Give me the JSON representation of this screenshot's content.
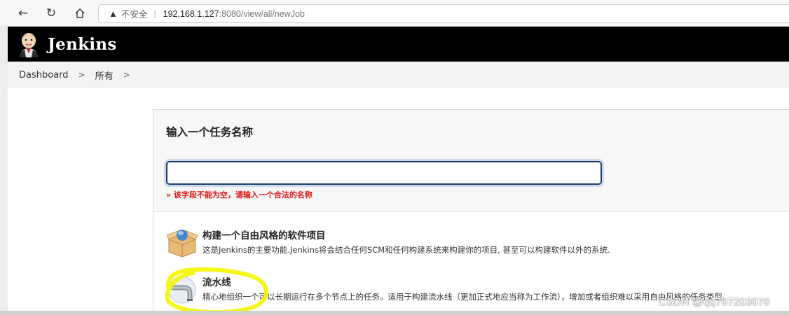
{
  "browser": {
    "back_icon": "back-arrow-icon",
    "reload_icon": "reload-icon",
    "home_icon": "home-icon",
    "security_text": "不安全",
    "url_host": "192.168.1.127",
    "url_path": ":8080/view/all/newJob"
  },
  "header": {
    "brand": "Jenkins",
    "logo_icon": "jenkins-butler-logo"
  },
  "breadcrumb": {
    "items": [
      "Dashboard",
      "所有"
    ],
    "separator": ">"
  },
  "form": {
    "title": "输入一个任务名称",
    "input_value": "",
    "error": "» 该字段不能为空，请输入一个合法的名称"
  },
  "job_types": [
    {
      "title": "构建一个自由风格的软件项目",
      "description": "这是Jenkins的主要功能.Jenkins将会结合任何SCM和任何构建系统来构建你的项目, 甚至可以构建软件以外的系统.",
      "icon": "freestyle-box-icon"
    },
    {
      "title": "流水线",
      "description": "精心地组织一个可以长期运行在多个节点上的任务。适用于构建流水线（更加正式地应当称为工作流），增加或者组织难以采用自由风格的任务类型。",
      "icon": "pipeline-icon"
    }
  ],
  "watermark": "CSDN @qq707203070",
  "colors": {
    "header_bg": "#000000",
    "error": "#e01919",
    "input_border": "#1c3f66",
    "highlight": "#f5f500"
  }
}
